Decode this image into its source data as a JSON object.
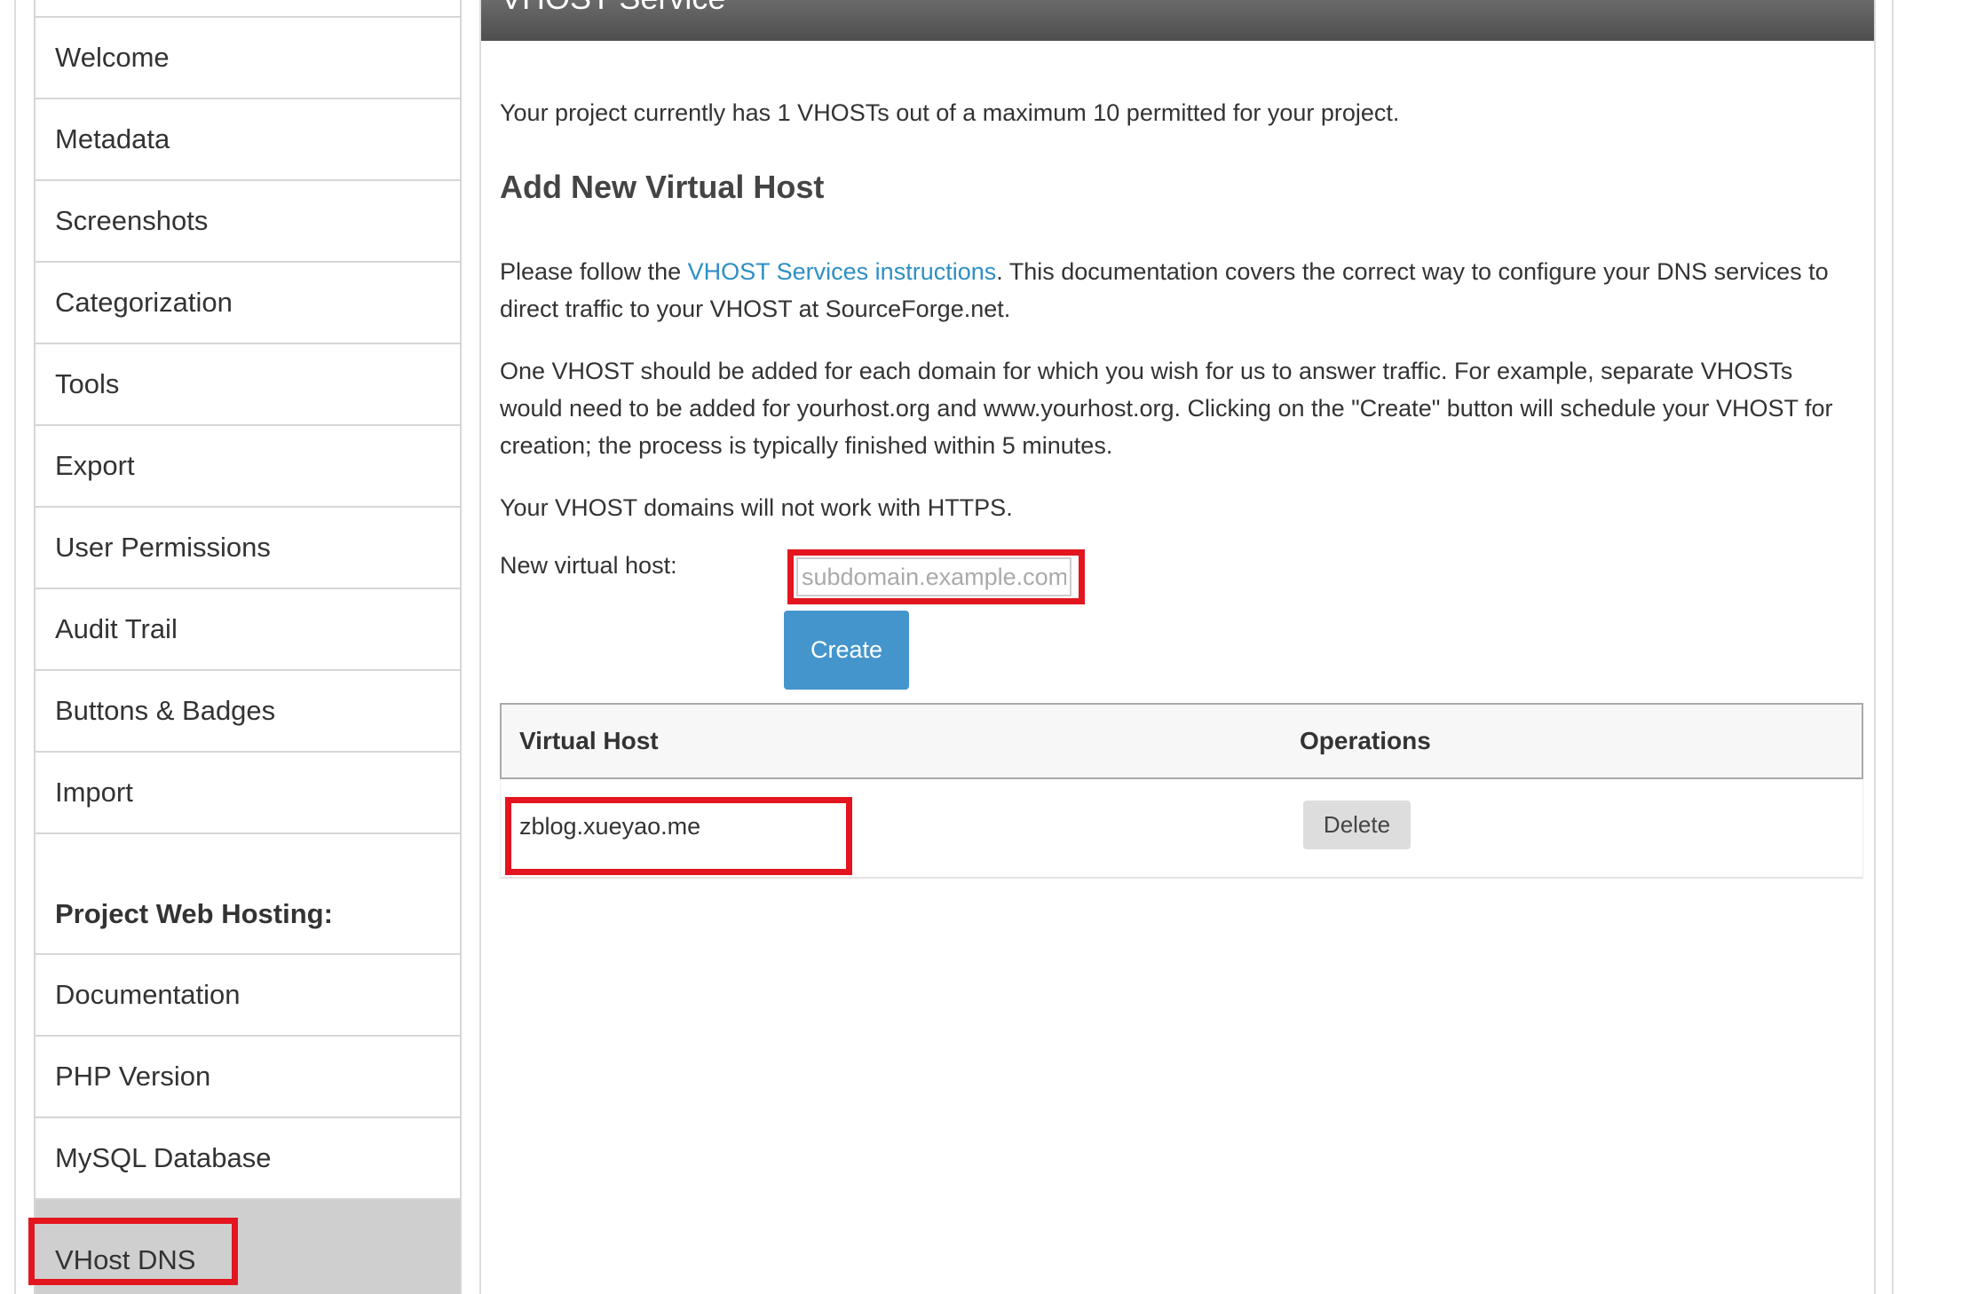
{
  "sidebar": {
    "items": [
      {
        "label": "Welcome"
      },
      {
        "label": "Metadata"
      },
      {
        "label": "Screenshots"
      },
      {
        "label": "Categorization"
      },
      {
        "label": "Tools"
      },
      {
        "label": "Export"
      },
      {
        "label": "User Permissions"
      },
      {
        "label": "Audit Trail"
      },
      {
        "label": "Buttons & Badges"
      },
      {
        "label": "Import"
      }
    ],
    "section_heading": "Project Web Hosting:",
    "hosting_items": [
      {
        "label": "Documentation"
      },
      {
        "label": "PHP Version"
      },
      {
        "label": "MySQL Database"
      },
      {
        "label": "VHost DNS",
        "active": true
      }
    ]
  },
  "main": {
    "header_title": "VHOST Service",
    "quota_text": "Your project currently has 1 VHOSTs out of a maximum 10 permitted for your project.",
    "section_title": "Add New Virtual Host",
    "instructions_prefix": "Please follow the ",
    "instructions_link": "VHOST Services instructions",
    "instructions_suffix": ". This documentation covers the correct way to configure your DNS services to direct traffic to your VHOST at SourceForge.net.",
    "explanation": "One VHOST should be added for each domain for which you wish for us to answer traffic. For example, separate VHOSTs would need to be added for yourhost.org and www.yourhost.org. Clicking on the \"Create\" button will schedule your VHOST for creation; the process is typically finished within 5 minutes.",
    "https_note": "Your VHOST domains will not work with HTTPS.",
    "form": {
      "label": "New virtual host:",
      "placeholder": "subdomain.example.com",
      "value": "",
      "create_label": "Create"
    },
    "table": {
      "headers": {
        "host": "Virtual Host",
        "operations": "Operations"
      },
      "rows": [
        {
          "host": "zblog.xueyao.me",
          "delete_label": "Delete"
        }
      ]
    }
  },
  "colors": {
    "highlight": "#e3151e",
    "create_button": "#4495cc",
    "link": "#2e8fc4",
    "header_bg": "#5a5a5a",
    "active_item_bg": "#cfcfcf"
  }
}
